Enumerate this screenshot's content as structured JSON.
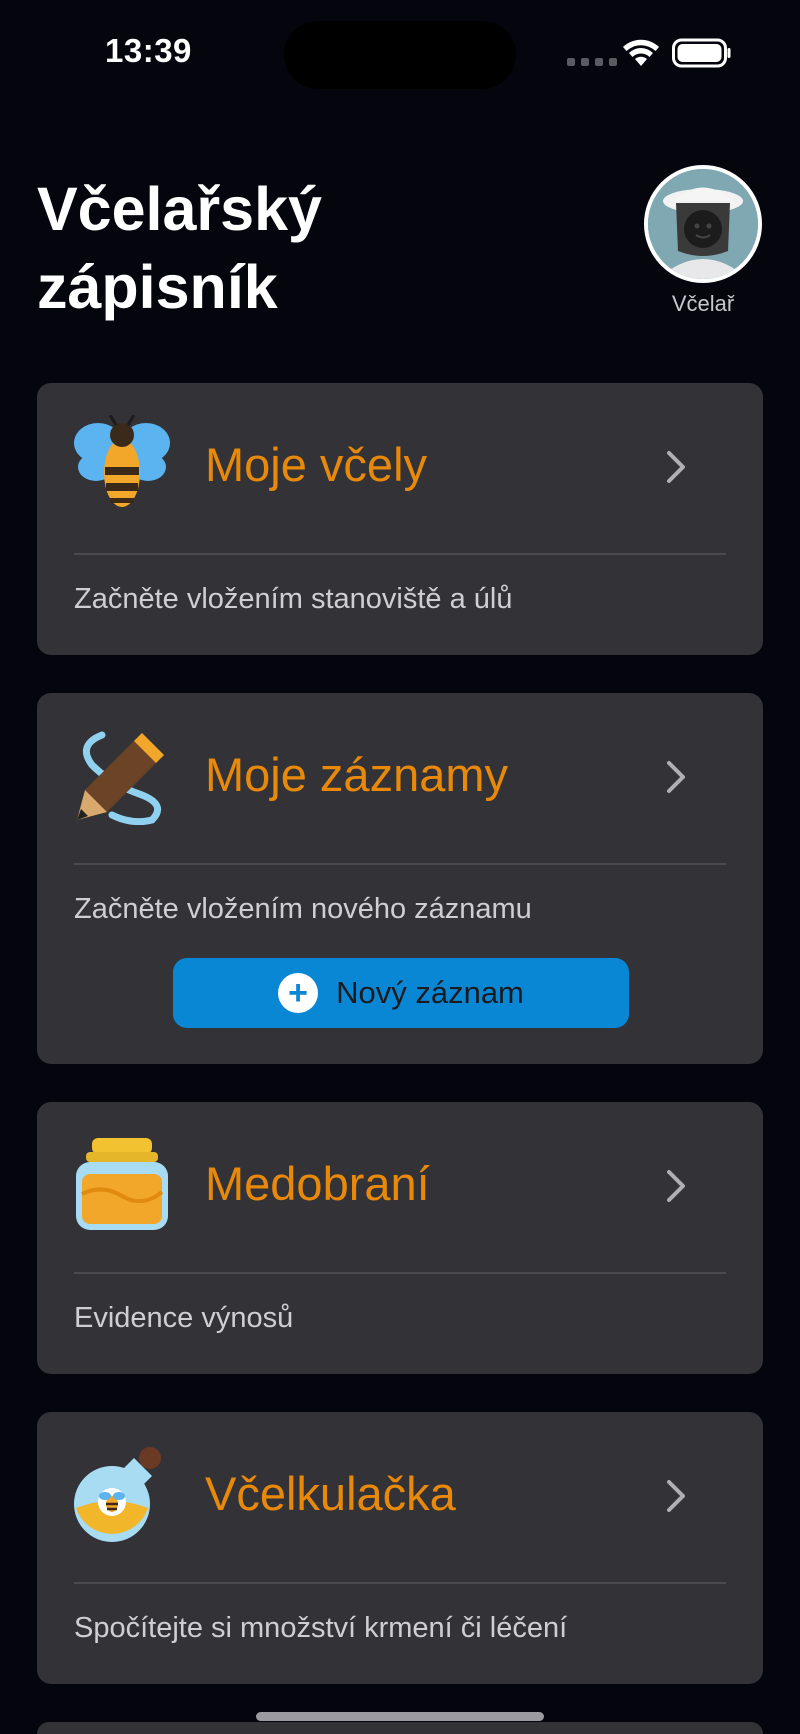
{
  "status_bar": {
    "time": "13:39"
  },
  "header": {
    "title": "Včelařský\nzápisník",
    "avatar_label": "Včelař"
  },
  "cards": [
    {
      "title": "Moje včely",
      "description": "Začněte vložením stanoviště a úlů",
      "icon": "bee-icon"
    },
    {
      "title": "Moje záznamy",
      "description": "Začněte vložením nového záznamu",
      "icon": "pencil-icon",
      "button_label": "Nový záznam"
    },
    {
      "title": "Medobraní",
      "description": "Evidence výnosů",
      "icon": "honey-jar-icon"
    },
    {
      "title": "Včelkulačka",
      "description": "Spočítejte si množství krmení či léčení",
      "icon": "potion-bottle-icon"
    }
  ],
  "colors": {
    "background": "#05050e",
    "card": "#323237",
    "accent": "#e8890a",
    "button": "#0a87d4"
  }
}
